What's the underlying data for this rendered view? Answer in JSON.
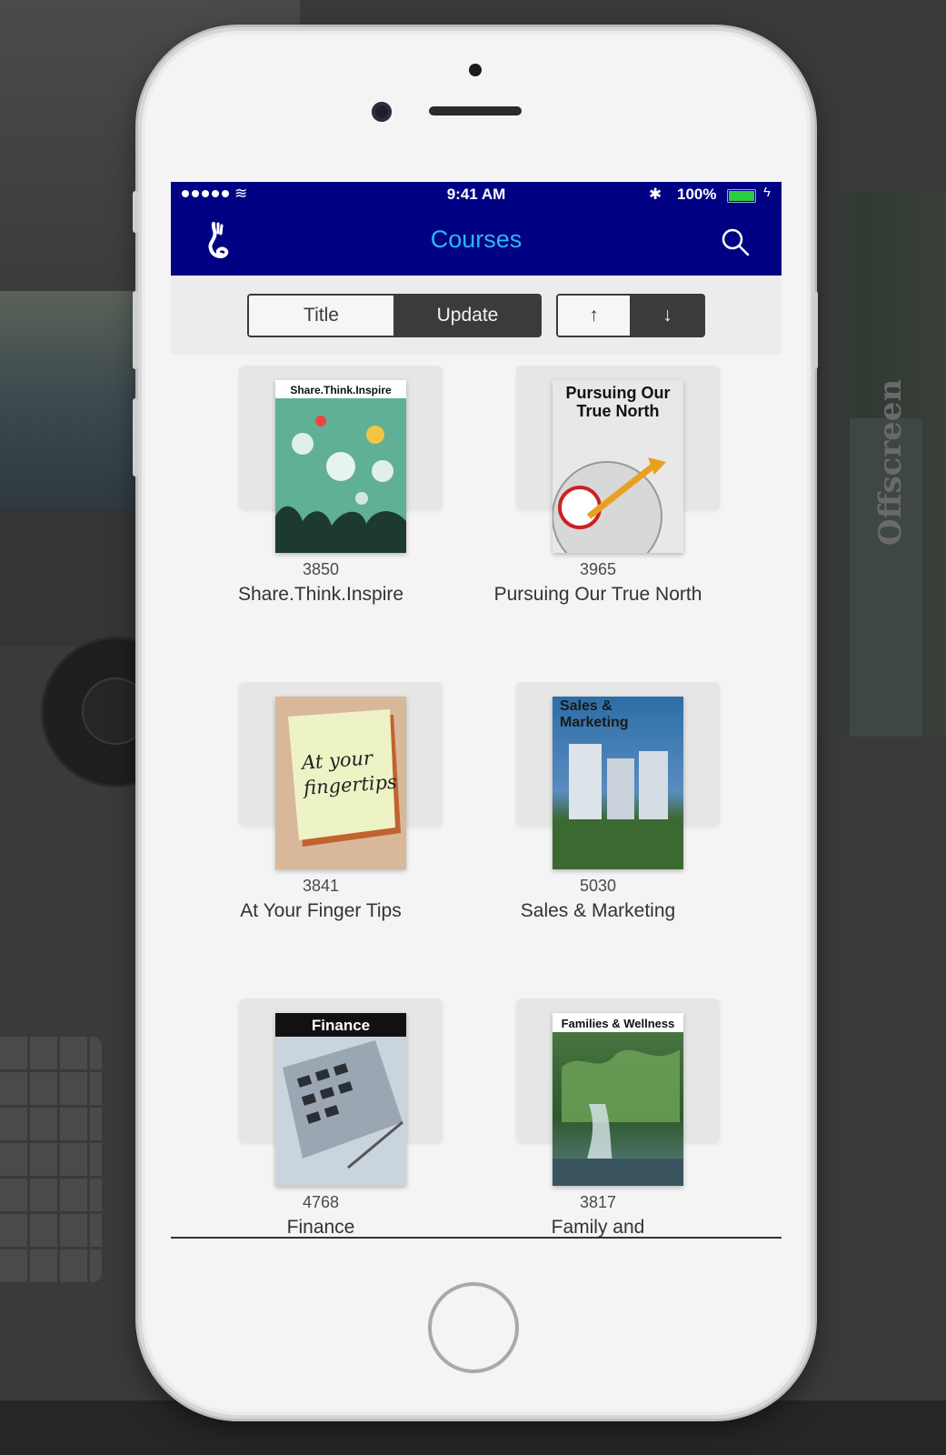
{
  "background": {
    "watermark": "Offscreen"
  },
  "status_bar": {
    "time": "9:41 AM",
    "battery": "100%",
    "bluetooth_glyph": "✱",
    "wifi_glyph": "≋"
  },
  "nav": {
    "title": "Courses"
  },
  "sort": {
    "title_label": "Title",
    "update_label": "Update",
    "ascending_label": "↑",
    "descending_label": "↓",
    "selected": "Update"
  },
  "courses": [
    {
      "id": "3850",
      "name": "Share.Think.Inspire",
      "cover_title": "Share.Think.Inspire",
      "cover_color": "#5fb095"
    },
    {
      "id": "3965",
      "name": "Pursuing Our True North",
      "cover_title": "Pursuing Our True North",
      "cover_color": "#e8e8e8"
    },
    {
      "id": "3841",
      "name": "At Your Finger Tips",
      "cover_title": "At your fingertips",
      "cover_color": "#d9b79a"
    },
    {
      "id": "5030",
      "name": "Sales & Marketing",
      "cover_title": "Sales & Marketing",
      "cover_color": "#2b6ea8"
    },
    {
      "id": "4768",
      "name": "Finance",
      "cover_title": "Finance",
      "cover_color": "#c9d4df"
    },
    {
      "id": "3817",
      "name": "Family and",
      "cover_title": "Families & Wellness",
      "cover_color": "#3d6b3a"
    }
  ]
}
